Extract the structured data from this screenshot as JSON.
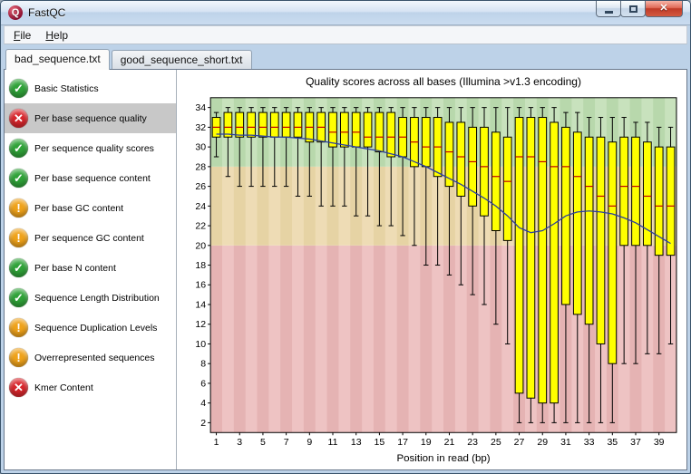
{
  "window": {
    "title": "FastQC"
  },
  "icons": {
    "pass": "✓",
    "warn": "!",
    "fail": "✕",
    "close": "✕",
    "app": "Q"
  },
  "menu": {
    "items": [
      {
        "label": "File"
      },
      {
        "label": "Help"
      }
    ]
  },
  "tabs": [
    {
      "label": "bad_sequence.txt",
      "active": true
    },
    {
      "label": "good_sequence_short.txt",
      "active": false
    }
  ],
  "sidebar": {
    "items": [
      {
        "label": "Basic Statistics",
        "status": "pass",
        "selected": false
      },
      {
        "label": "Per base sequence quality",
        "status": "fail",
        "selected": true
      },
      {
        "label": "Per sequence quality scores",
        "status": "pass",
        "selected": false
      },
      {
        "label": "Per base sequence content",
        "status": "pass",
        "selected": false
      },
      {
        "label": "Per base GC content",
        "status": "warn",
        "selected": false
      },
      {
        "label": "Per sequence GC content",
        "status": "warn",
        "selected": false
      },
      {
        "label": "Per base N content",
        "status": "pass",
        "selected": false
      },
      {
        "label": "Sequence Length Distribution",
        "status": "pass",
        "selected": false
      },
      {
        "label": "Sequence Duplication Levels",
        "status": "warn",
        "selected": false
      },
      {
        "label": "Overrepresented sequences",
        "status": "warn",
        "selected": false
      },
      {
        "label": "Kmer Content",
        "status": "fail",
        "selected": false
      }
    ]
  },
  "chart_data": {
    "type": "boxplot",
    "title": "Quality scores across all bases (Illumina >v1.3 encoding)",
    "xlabel": "Position in read (bp)",
    "ylabel": "",
    "ylim": [
      1,
      35
    ],
    "y_ticks": [
      2,
      4,
      6,
      8,
      10,
      12,
      14,
      16,
      18,
      20,
      22,
      24,
      26,
      28,
      30,
      32,
      34
    ],
    "x": [
      1,
      2,
      3,
      4,
      5,
      6,
      7,
      8,
      9,
      10,
      11,
      12,
      13,
      14,
      15,
      16,
      17,
      18,
      19,
      20,
      21,
      22,
      23,
      24,
      25,
      26,
      27,
      28,
      29,
      30,
      31,
      32,
      33,
      34,
      35,
      36,
      37,
      38,
      39,
      40
    ],
    "x_tick_labels": [
      1,
      3,
      5,
      7,
      9,
      11,
      13,
      15,
      17,
      19,
      21,
      23,
      25,
      27,
      29,
      31,
      33,
      35,
      37,
      39
    ],
    "zones": [
      {
        "name": "fail",
        "range": [
          1,
          20
        ],
        "color": "#e5b3b3",
        "alt_color": "#eec3c3"
      },
      {
        "name": "warn",
        "range": [
          20,
          28
        ],
        "color": "#e6d3a4",
        "alt_color": "#eedcb5"
      },
      {
        "name": "pass",
        "range": [
          28,
          35
        ],
        "color": "#b8d8ac",
        "alt_color": "#c8e2bd"
      }
    ],
    "series": {
      "lower_whisker": [
        29,
        27,
        26,
        26,
        26,
        26,
        26,
        25,
        25,
        24,
        24,
        24,
        23,
        23,
        22,
        22,
        21,
        20,
        18,
        18,
        17,
        16,
        15,
        14,
        12,
        10,
        2,
        2,
        2,
        2,
        2,
        2,
        2,
        2,
        2,
        8,
        8,
        9,
        9,
        10
      ],
      "q1": [
        31,
        31,
        31,
        31,
        31,
        31,
        31,
        31,
        30.5,
        30.5,
        30,
        30,
        30,
        30,
        29.5,
        29,
        29,
        28,
        28,
        27,
        26,
        25,
        24,
        23,
        21.5,
        20.5,
        5,
        4.5,
        4,
        4,
        14,
        13,
        12,
        10,
        8,
        20,
        20,
        20,
        19,
        19
      ],
      "median": [
        32,
        32,
        32,
        32,
        32,
        32,
        32,
        32,
        32,
        32,
        31.5,
        31.5,
        31.5,
        31,
        31,
        31,
        31,
        30.5,
        30,
        30,
        29.5,
        29,
        28.5,
        28,
        27,
        26.5,
        29,
        29,
        28.5,
        28,
        28,
        27,
        26,
        25,
        24,
        26,
        26,
        25,
        24,
        24
      ],
      "q3": [
        33,
        33.5,
        33.5,
        33.5,
        33.5,
        33.5,
        33.5,
        33.5,
        33.5,
        33.5,
        33.5,
        33.5,
        33.5,
        33.5,
        33.5,
        33.5,
        33,
        33,
        33,
        33,
        32.5,
        32.5,
        32,
        32,
        31.5,
        31,
        33,
        33,
        33,
        32.5,
        32,
        31.5,
        31,
        31,
        30.5,
        31,
        31,
        30.5,
        30,
        30
      ],
      "upper_whisker": [
        33.5,
        34,
        34,
        34,
        34,
        34,
        34,
        34,
        34,
        34,
        34,
        34,
        34,
        34,
        34,
        34,
        34,
        34,
        34,
        34,
        34,
        34,
        34,
        34,
        34,
        34,
        34,
        34,
        34,
        34,
        33.5,
        33.5,
        33,
        33,
        33,
        33,
        32.5,
        32.5,
        32,
        32
      ],
      "mean": [
        31.3,
        31.3,
        31.2,
        31.2,
        31.1,
        31,
        31,
        30.9,
        30.8,
        30.6,
        30.4,
        30.2,
        30,
        29.8,
        29.6,
        29.3,
        29,
        28.5,
        28,
        27.4,
        26.8,
        26.2,
        25.5,
        24.8,
        24,
        23,
        21.8,
        21.3,
        21.5,
        22.2,
        23,
        23.4,
        23.5,
        23.4,
        23.2,
        22.8,
        22.3,
        21.6,
        20.9,
        20.2
      ]
    },
    "colors": {
      "box": "#ffff00",
      "median": "#c00000",
      "mean": "#2b3f9e",
      "whisker": "#000000"
    },
    "legend": "none",
    "grid": false
  }
}
